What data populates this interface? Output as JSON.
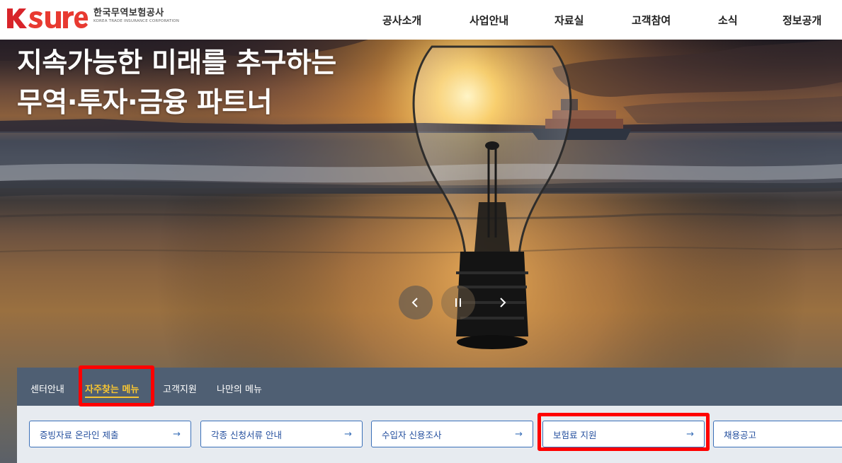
{
  "header": {
    "logo": {
      "mark": "KSURE",
      "korean_name": "한국무역보험공사",
      "english_name": "KOREA TRADE INSURANCE CORPORATION"
    },
    "nav": [
      {
        "label": "공사소개"
      },
      {
        "label": "사업안내"
      },
      {
        "label": "자료실"
      },
      {
        "label": "고객참여"
      },
      {
        "label": "소식"
      },
      {
        "label": "정보공개"
      }
    ]
  },
  "hero": {
    "title_line1": "지속가능한 미래를 추구하는",
    "title_line2": "무역·투자·금융 파트너",
    "controls": {
      "prev_icon": "chevron-left-icon",
      "pause_icon": "pause-icon",
      "next_icon": "chevron-right-icon"
    }
  },
  "quick_menu": {
    "tabs": [
      {
        "label": "센터안내",
        "active": false
      },
      {
        "label": "자주찾는 메뉴",
        "active": true
      },
      {
        "label": "고객지원",
        "active": false
      },
      {
        "label": "나만의 메뉴",
        "active": false
      }
    ],
    "cards": [
      {
        "label": "증빙자료 온라인 제출",
        "arrow": "→"
      },
      {
        "label": "각종 신청서류 안내",
        "arrow": "→"
      },
      {
        "label": "수입자 신용조사",
        "arrow": "→"
      },
      {
        "label": "보험료 지원",
        "arrow": "→"
      },
      {
        "label": "채용공고",
        "arrow": "→"
      }
    ]
  },
  "colors": {
    "brand_red": "#e8322b",
    "tab_bar": "#4f5f73",
    "active_tab": "#f7c531",
    "card_border": "#3a6fb8",
    "highlight": "#ff0000"
  }
}
